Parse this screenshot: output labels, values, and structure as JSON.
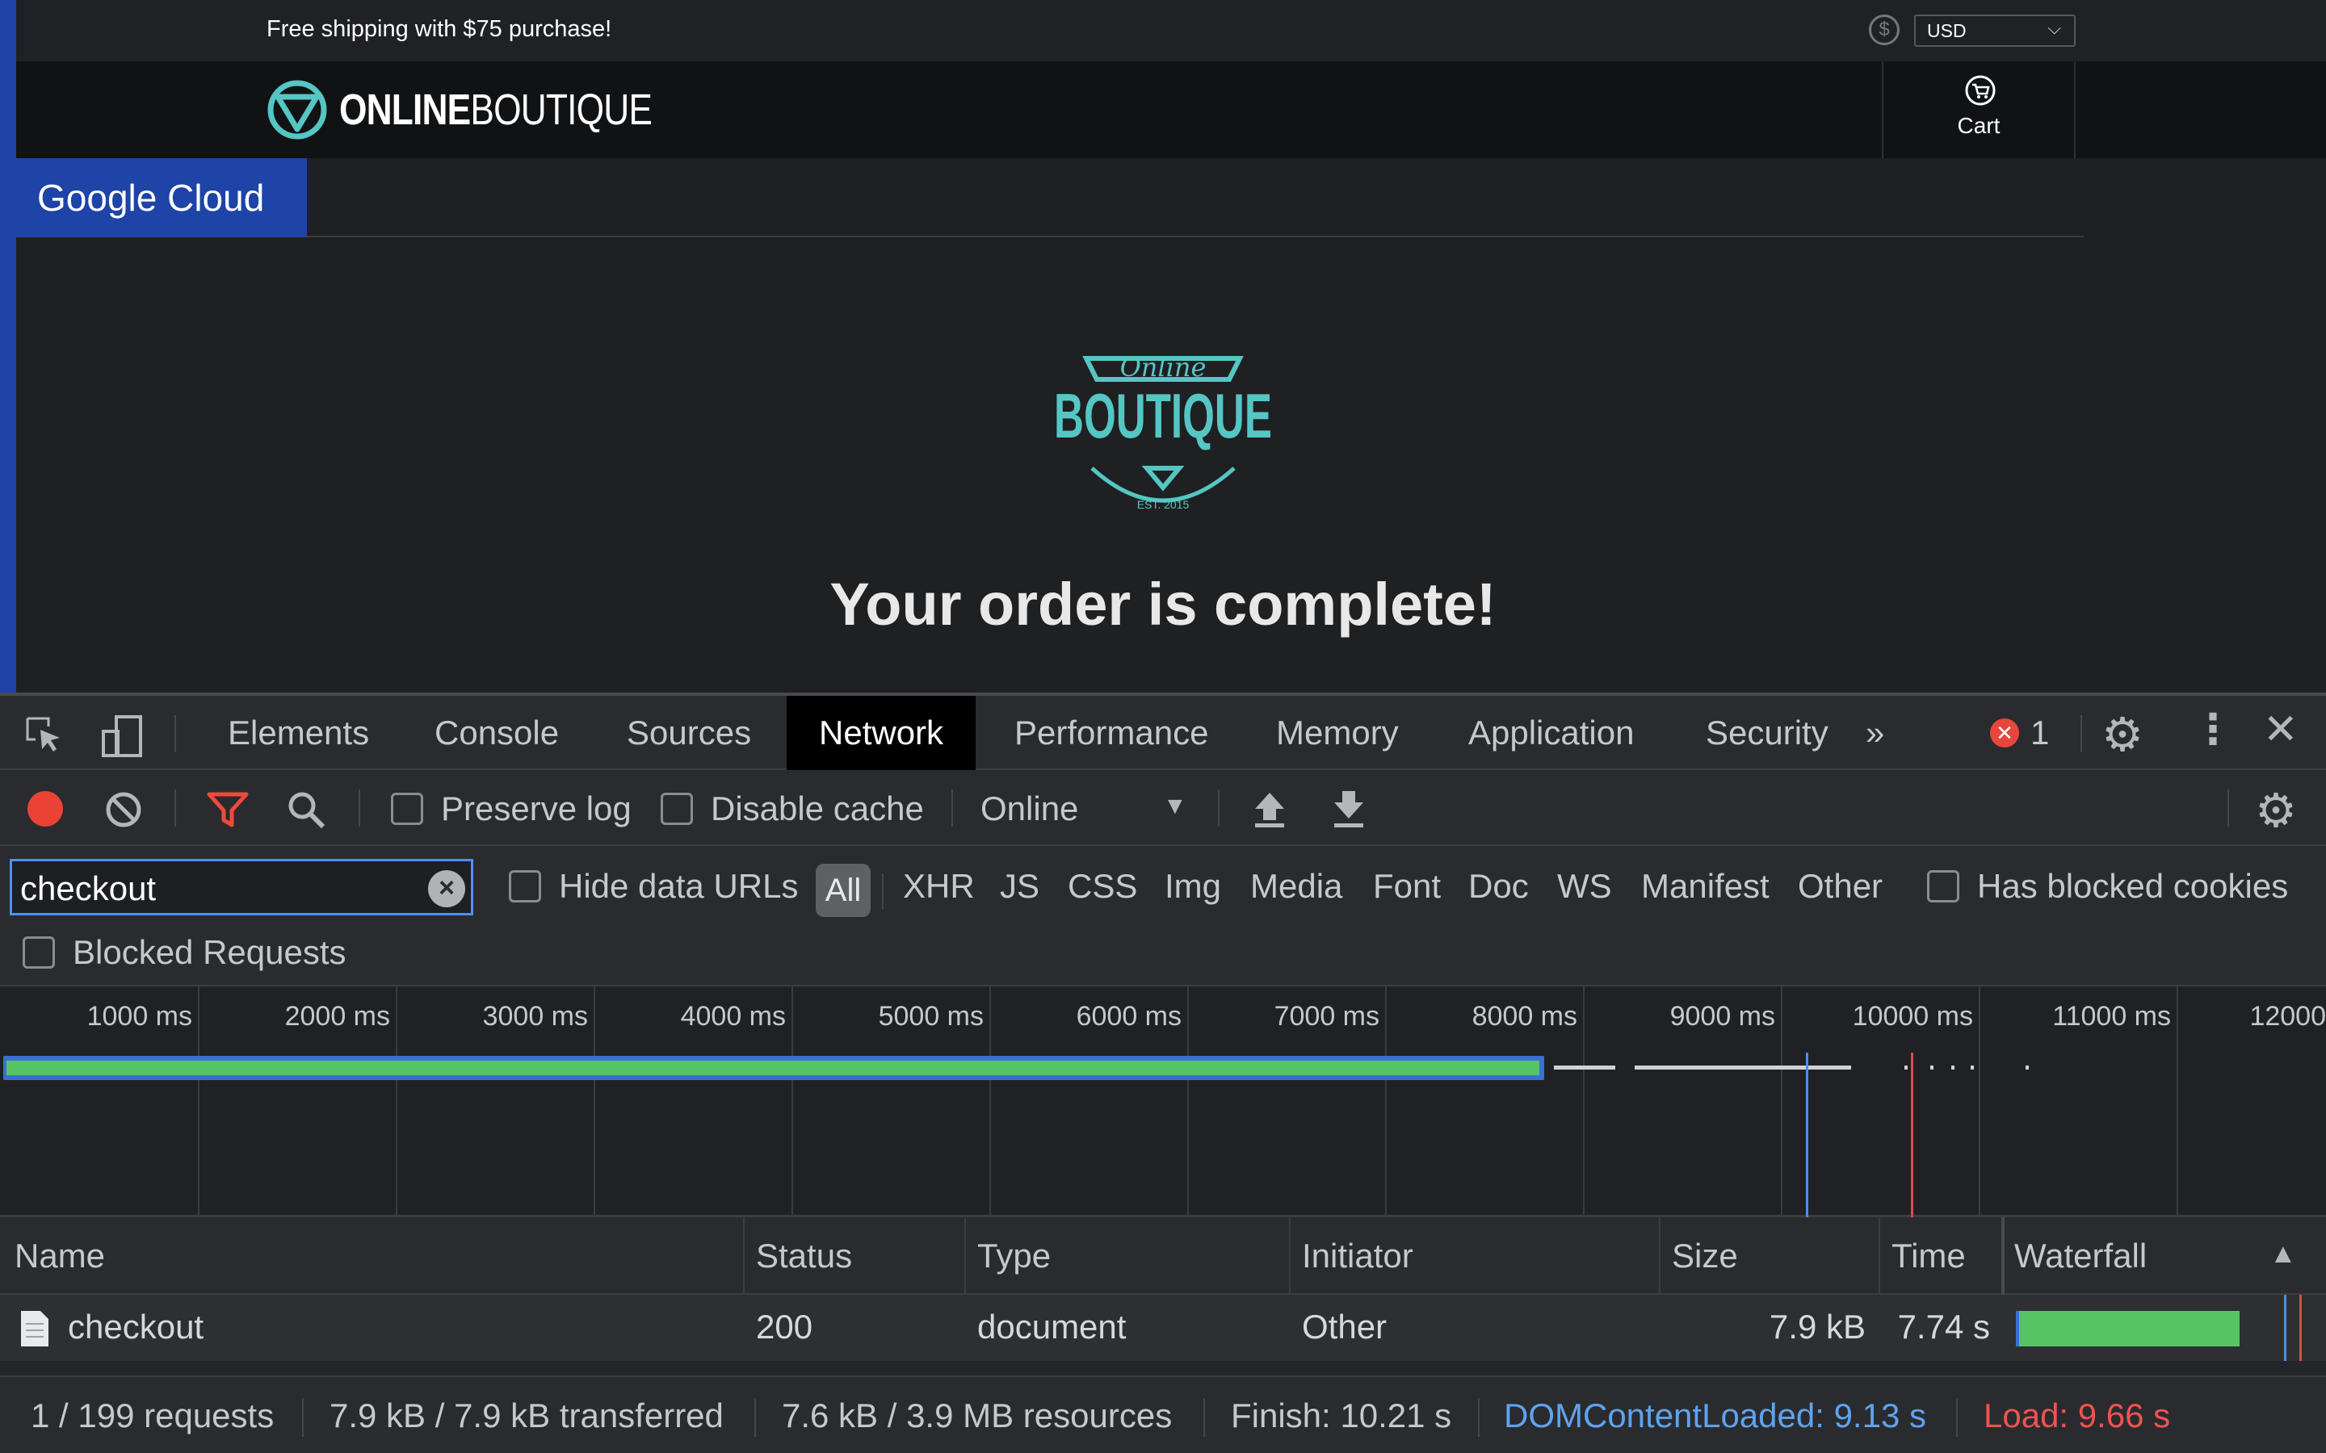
{
  "page": {
    "shipping_banner": "Free shipping with $75 purchase!",
    "currency_selected": "USD",
    "brand_bold": "ONLINE",
    "brand_light": "BOUTIQUE",
    "cart_label": "Cart",
    "google_cloud_tab": "Google Cloud",
    "hero_logo": {
      "script": "Online",
      "word": "BOUTIQUE",
      "est": "EST. 2015"
    },
    "order_title": "Your order is complete!"
  },
  "devtools": {
    "tabs": [
      "Elements",
      "Console",
      "Sources",
      "Network",
      "Performance",
      "Memory",
      "Application",
      "Security"
    ],
    "active_tab": "Network",
    "more_tabs": "»",
    "error_count": "1",
    "toolbar": {
      "preserve_log": "Preserve log",
      "disable_cache": "Disable cache",
      "throttling": "Online"
    },
    "filter": {
      "value": "checkout",
      "hide_data_urls": "Hide data URLs",
      "types": [
        "All",
        "XHR",
        "JS",
        "CSS",
        "Img",
        "Media",
        "Font",
        "Doc",
        "WS",
        "Manifest",
        "Other"
      ],
      "active_type": "All",
      "has_blocked_cookies": "Has blocked cookies",
      "blocked_requests": "Blocked Requests"
    },
    "overview": {
      "ticks": [
        "1000 ms",
        "2000 ms",
        "3000 ms",
        "4000 ms",
        "5000 ms",
        "6000 ms",
        "7000 ms",
        "8000 ms",
        "9000 ms",
        "10000 ms",
        "11000 ms",
        "12000"
      ],
      "request_bar_end_ms": 7740,
      "dom_content_loaded_ms": 9130,
      "load_ms": 9660,
      "colors": {
        "waiting": "#3b6fd8",
        "download": "#57c466",
        "dcl": "#4a90e2",
        "load": "#e04848"
      }
    },
    "table": {
      "headers": {
        "name": "Name",
        "status": "Status",
        "type": "Type",
        "initiator": "Initiator",
        "size": "Size",
        "time": "Time",
        "waterfall": "Waterfall"
      },
      "rows": [
        {
          "name": "checkout",
          "status": "200",
          "type": "document",
          "initiator": "Other",
          "size": "7.9 kB",
          "time": "7.74 s"
        }
      ]
    },
    "status_bar": {
      "requests": "1 / 199 requests",
      "transferred": "7.9 kB / 7.9 kB transferred",
      "resources": "7.6 kB / 3.9 MB resources",
      "finish": "Finish: 10.21 s",
      "dom_content_loaded": "DOMContentLoaded: 9.13 s",
      "load": "Load: 9.66 s"
    }
  }
}
